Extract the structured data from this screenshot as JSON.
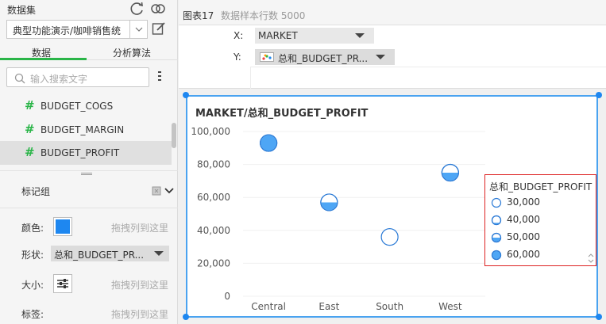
{
  "left": {
    "title": "数据集",
    "dataset_select": "典型功能演示/咖啡销售统",
    "tabs": [
      "数据",
      "分析算法"
    ],
    "search_placeholder": "输入搜索文字",
    "fields": [
      "BUDGET_COGS",
      "BUDGET_MARGIN",
      "BUDGET_PROFIT"
    ],
    "mark_group": "标记组",
    "props": {
      "color_label": "颜色:",
      "color_value": "#1e87f0",
      "color_drop": "拖拽列到这里",
      "shape_label": "形状:",
      "shape_value": "总和_BUDGET_PR...",
      "size_label": "大小:",
      "size_drop": "拖拽列到这里",
      "tag_label": "标签:",
      "tag_drop": "拖拽列到这里"
    }
  },
  "right": {
    "chart_name": "图表17",
    "rows_text": "数据样本行数 5000",
    "x_label": "X:",
    "x_value": "MARKET",
    "y_label": "Y:",
    "y_value": "总和_BUDGET_PR..."
  },
  "chart_data": {
    "type": "scatter",
    "title": "MARKET/总和_BUDGET_PROFIT",
    "categories": [
      "Central",
      "East",
      "South",
      "West"
    ],
    "values": [
      93000,
      57000,
      36000,
      75000
    ],
    "shape_levels": [
      60000,
      50000,
      30000,
      50000
    ],
    "ylim": [
      0,
      100000
    ],
    "yticks": [
      "0",
      "20,000",
      "40,000",
      "60,000",
      "80,000",
      "100,000"
    ],
    "accent": "#4ea6f5",
    "legend": {
      "title": "总和_BUDGET_PROFIT",
      "position": "right",
      "entries": [
        {
          "label": "30,000",
          "level": 30000
        },
        {
          "label": "40,000",
          "level": 40000
        },
        {
          "label": "50,000",
          "level": 50000
        },
        {
          "label": "60,000",
          "level": 60000
        }
      ]
    }
  }
}
